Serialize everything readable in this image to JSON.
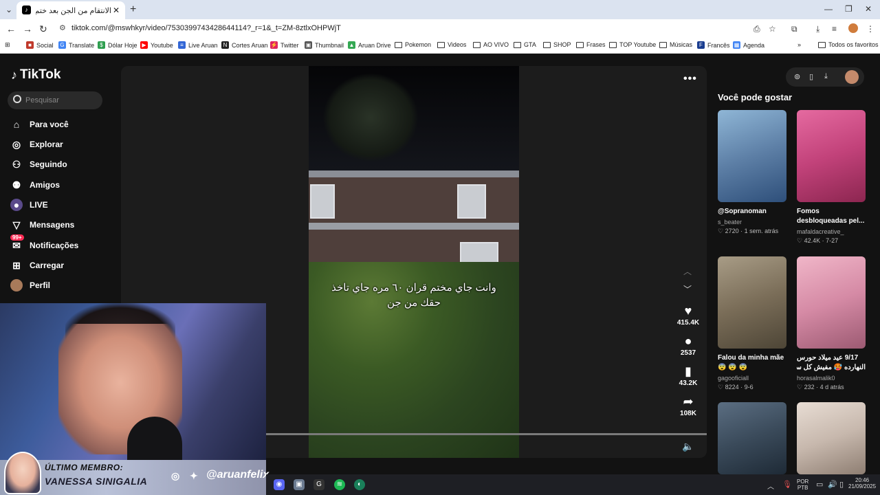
{
  "browser": {
    "tab_title": "الانتقام من الجن بعد ختم القر...",
    "url": "tiktok.com/@mswhkyr/video/7530399743428644114?_r=1&_t=ZM-8ztlxOHPWjT",
    "bookmarks": [
      "Social",
      "Translate",
      "Dólar Hoje",
      "Youtube",
      "Live Aruan",
      "Cortes Aruan",
      "Twitter",
      "Thumbnail",
      "Aruan Drive",
      "Pokemon",
      "Videos",
      "AO VIVO",
      "GTA",
      "SHOP",
      "Frases",
      "TOP Youtube",
      "Músicas",
      "Francês",
      "Agenda"
    ],
    "all_bookmarks": "Todos os favoritos"
  },
  "tiktok": {
    "logo": "TikTok",
    "search_placeholder": "Pesquisar",
    "nav": [
      "Para você",
      "Explorar",
      "Seguindo",
      "Amigos",
      "LIVE",
      "Mensagens",
      "Notificações",
      "Carregar",
      "Perfil"
    ],
    "notif_badge": "99+",
    "caption": "وانت جاي مختم قران ٦٠ مره جاي تاخذ حقك من جن",
    "likes": "415.4K",
    "comments": "2537",
    "saves": "43.2K",
    "shares": "108K",
    "recs_title": "Você pode gostar",
    "recs": [
      {
        "title": "@Sopranoman",
        "title2": "",
        "user": "s_beater",
        "stats": "♡ 2720 · 1 sem. atrás",
        "color": "#6a8fb8"
      },
      {
        "title": "Fomos",
        "title2": "desbloqueadas pel...",
        "user": "mafaldacreative_",
        "stats": "♡ 42.4K · 7-27",
        "color": "#c2427a"
      },
      {
        "title": "Falou da minha mãe",
        "title2": "😨 😨 😨",
        "user": "gagooficiall",
        "stats": "♡ 8224 · 9-6",
        "color": "#8a7f6a"
      },
      {
        "title": "9/17 عيد ميلاد حورس",
        "title2": "النهارده 🥵 مفيش كل سنه",
        "user": "horasalmalik0",
        "stats": "♡ 232 · 4 d atrás",
        "color": "#d58aa5"
      },
      {
        "title": "",
        "title2": "",
        "user": "",
        "stats": "",
        "color": "#3a4a5a"
      },
      {
        "title": "",
        "title2": "",
        "user": "",
        "stats": "",
        "color": "#c7b8ad"
      }
    ]
  },
  "overlay": {
    "line1": "ÚLTIMO MEMBRO:",
    "line2": "VANESSA SINIGALIA",
    "handle": "@aruanfelix"
  },
  "taskbar": {
    "lang1": "POR",
    "lang2": "PTB",
    "time": "20:46",
    "date": "21/09/2025"
  }
}
